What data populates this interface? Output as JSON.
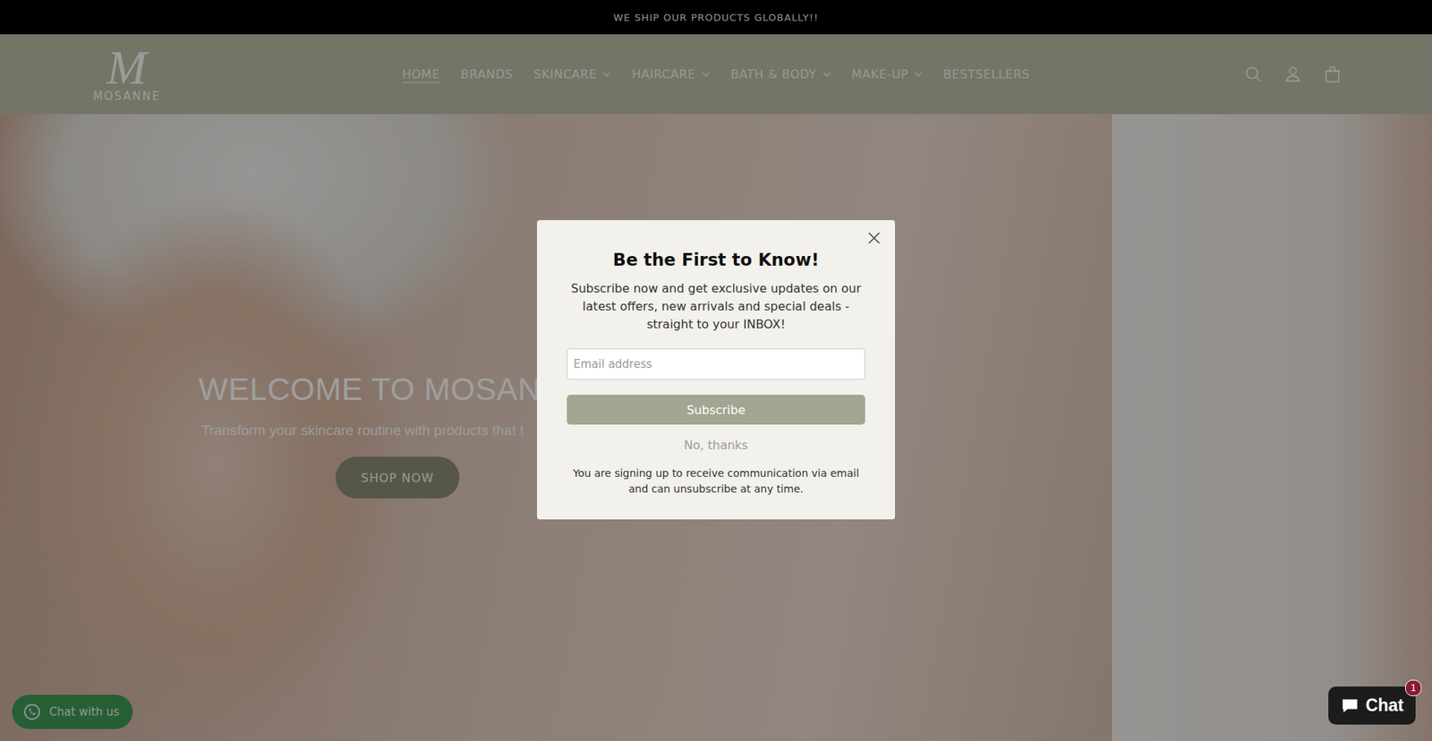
{
  "announcement": "WE SHIP OUR PRODUCTS GLOBALLY!!",
  "logo": {
    "mark": "M",
    "name": "MOSANNE"
  },
  "nav": [
    {
      "label": "HOME",
      "selected": true,
      "dropdown": false
    },
    {
      "label": "BRANDS",
      "selected": false,
      "dropdown": false
    },
    {
      "label": "SKINCARE",
      "selected": false,
      "dropdown": true
    },
    {
      "label": "HAIRCARE",
      "selected": false,
      "dropdown": true
    },
    {
      "label": "BATH & BODY",
      "selected": false,
      "dropdown": true
    },
    {
      "label": "MAKE-UP",
      "selected": false,
      "dropdown": true
    },
    {
      "label": "BESTSELLERS",
      "selected": false,
      "dropdown": false
    }
  ],
  "hero": {
    "title": "WELCOME TO MOSAN",
    "subtitle": "Transform your skincare routine with products that t",
    "button": "SHOP NOW"
  },
  "popup": {
    "title": "Be the First to Know!",
    "body": "Subscribe now and get exclusive updates on our latest offers, new arrivals and special deals - straight to your INBOX!",
    "email_placeholder": "Email address",
    "subscribe": "Subscribe",
    "decline": "No, thanks",
    "disclaimer": "You are signing up to receive communication via email and can unsubscribe at any time."
  },
  "whatsapp": {
    "label": "Chat with us"
  },
  "shop_chat": {
    "label": "Chat",
    "badge": "1"
  }
}
